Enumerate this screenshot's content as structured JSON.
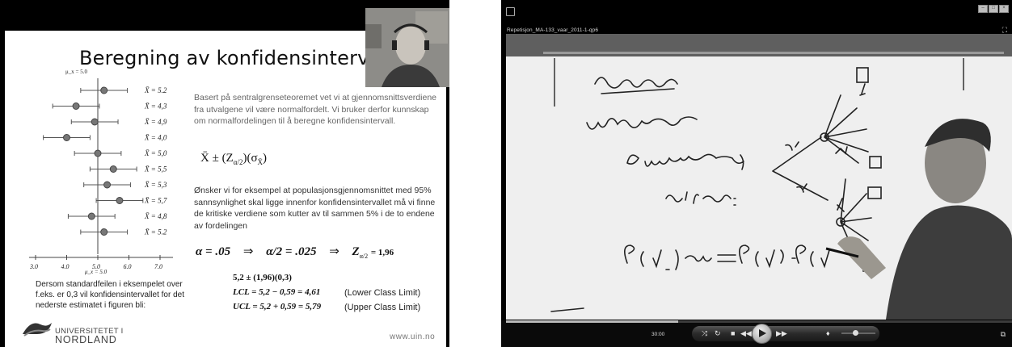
{
  "slide": {
    "title": "Beregning av konfidensintervall",
    "mu_top": "μ_x = 5.0",
    "mu_bottom": "μ_x = 5.0",
    "means": [
      {
        "label": "X̄ = 5.2",
        "value": 5.2
      },
      {
        "label": "X̄ = 4,3",
        "value": 4.3
      },
      {
        "label": "X̄ = 4,9",
        "value": 4.9
      },
      {
        "label": "X̄ = 4,0",
        "value": 4.0
      },
      {
        "label": "X̄ = 5,0",
        "value": 5.0
      },
      {
        "label": "X̄ = 5,5",
        "value": 5.5
      },
      {
        "label": "X̄ = 5,3",
        "value": 5.3
      },
      {
        "label": "X̄ = 5,7",
        "value": 5.7
      },
      {
        "label": "X̄ = 4,8",
        "value": 4.8
      },
      {
        "label": "X̄ = 5.2",
        "value": 5.2
      }
    ],
    "axis_ticks": [
      "3.0",
      "4.0",
      "5.0",
      "6.0",
      "7.0"
    ],
    "para1": "Basert på sentralgrenseteoremet vet vi at gjennomsnittsverdiene fra utvalgene vil være normalfordelt. Vi bruker derfor kunnskap om normalfordelingen til å beregne konfidensintervall.",
    "formula_ci": "X̄ ± (Z",
    "formula_ci_sub": "α/2",
    "formula_ci_end": ")(σ",
    "formula_ci_sub2": "X̄",
    "formula_ci_close": ")",
    "para2": "Ønsker vi for eksempel at populasjonsgjennomsnittet med 95% sannsynlighet skal ligge innenfor konfidensintervallet må vi finne de kritiske verdiene som kutter av til sammen 5% i de to endene av fordelingen",
    "alpha_eq": "α = .05",
    "arrow": "⇒",
    "half_alpha_eq": "α/2 = .025",
    "z_label": "Z",
    "z_sub": "α/2",
    "z_value": "= 1,96",
    "para3": "Dersom standardfeilen i eksempelet over f.eks. er 0,3 vil konfidensintervallet for det nederste estimatet i figuren bli:",
    "calc1": "5,2 ± (1,96)(0,3)",
    "lcl": "LCL = 5,2 − 0,59 = 4,61",
    "lcl_note": "(Lower Class Limit)",
    "ucl": "UCL = 5,2 + 0,59 = 5,79",
    "ucl_note": "(Upper Class Limit)",
    "uni_line1": "UNIVERSITETET I",
    "uni_line2": "NORDLAND",
    "website": "www.uin.no"
  },
  "player": {
    "title": "Repetisjon_MA-133_vaar_2011-1-qp6",
    "time": "30:00",
    "progress": 0.34,
    "volume": 0.4
  }
}
